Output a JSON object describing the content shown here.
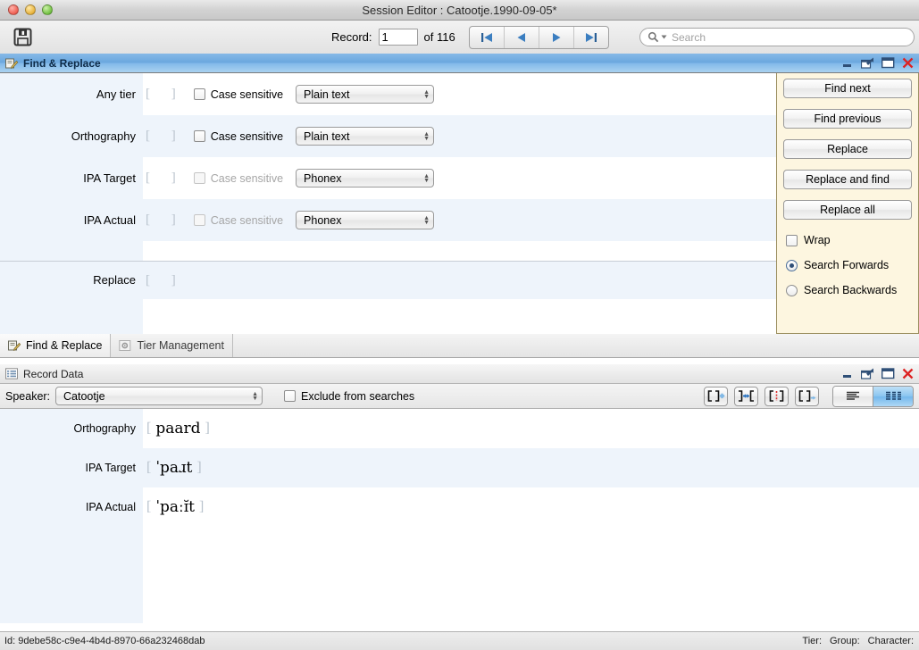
{
  "window": {
    "title": "Session Editor : Catootje.1990-09-05*",
    "traffic_lights": [
      "close-button",
      "minimize-button",
      "zoom-button"
    ]
  },
  "toolbar": {
    "save_icon": "save-disk-icon",
    "record_label": "Record:",
    "record_value": "1",
    "of_label": "of 116",
    "nav": [
      {
        "name": "first-record-button",
        "icon": "skip-to-start-icon"
      },
      {
        "name": "previous-record-button",
        "icon": "triangle-left-icon"
      },
      {
        "name": "next-record-button",
        "icon": "triangle-right-icon"
      },
      {
        "name": "last-record-button",
        "icon": "skip-to-end-icon"
      }
    ],
    "search_placeholder": "Search",
    "search_value": "",
    "search_icon": "magnifier-icon"
  },
  "find_replace": {
    "title": "Find & Replace",
    "title_icon": "find-replace-icon",
    "window_controls": [
      {
        "name": "minimize-icon",
        "label": "_"
      },
      {
        "name": "float-icon",
        "label": "float"
      },
      {
        "name": "maximize-icon",
        "label": "maximize"
      },
      {
        "name": "close-icon",
        "label": "x"
      }
    ],
    "rows": [
      {
        "label": "Any tier",
        "field_value": "",
        "case_sensitive_label": "Case sensitive",
        "case_sensitive_checked": false,
        "case_sensitive_enabled": true,
        "mode": "Plain text",
        "stripe": "white"
      },
      {
        "label": "Orthography",
        "field_value": "",
        "case_sensitive_label": "Case sensitive",
        "case_sensitive_checked": false,
        "case_sensitive_enabled": true,
        "mode": "Plain text",
        "stripe": "lblue"
      },
      {
        "label": "IPA Target",
        "field_value": "",
        "case_sensitive_label": "Case sensitive",
        "case_sensitive_checked": false,
        "case_sensitive_enabled": false,
        "mode": "Phonex",
        "stripe": "white"
      },
      {
        "label": "IPA Actual",
        "field_value": "",
        "case_sensitive_label": "Case sensitive",
        "case_sensitive_checked": false,
        "case_sensitive_enabled": false,
        "mode": "Phonex",
        "stripe": "lblue"
      }
    ],
    "replace": {
      "label": "Replace",
      "field_value": ""
    },
    "buttons": [
      "Find next",
      "Find previous",
      "Replace",
      "Replace and find",
      "Replace all"
    ],
    "options": {
      "wrap": {
        "label": "Wrap",
        "checked": false
      },
      "forwards": {
        "label": "Search Forwards",
        "selected": true
      },
      "backwards": {
        "label": "Search Backwards",
        "selected": false
      }
    }
  },
  "tabs": [
    {
      "label": "Find & Replace",
      "icon": "find-replace-icon",
      "active": true
    },
    {
      "label": "Tier Management",
      "icon": "tier-management-icon",
      "active": false
    }
  ],
  "record_data": {
    "title": "Record Data",
    "title_icon": "record-list-icon",
    "window_controls": [
      {
        "name": "minimize-icon",
        "label": "_"
      },
      {
        "name": "float-icon",
        "label": "float"
      },
      {
        "name": "maximize-icon",
        "label": "maximize"
      },
      {
        "name": "close-icon",
        "label": "x"
      }
    ],
    "speaker_label": "Speaker:",
    "speaker_value": "Catootje",
    "exclude_label": "Exclude from searches",
    "exclude_checked": false,
    "group_buttons": [
      {
        "name": "add-group-button",
        "glyph": "[ ]+"
      },
      {
        "name": "merge-group-button",
        "glyph": "}={"
      },
      {
        "name": "split-group-button",
        "glyph": "[ | ]"
      },
      {
        "name": "remove-group-button",
        "glyph": "[ ]→"
      }
    ],
    "view_toggles": [
      {
        "name": "single-column-view-button",
        "selected": false
      },
      {
        "name": "multi-column-view-button",
        "selected": true
      }
    ],
    "tiers": [
      {
        "label": "Orthography",
        "value": "paard",
        "stripe": "white"
      },
      {
        "label": "IPA Target",
        "value": "ˈpaɹt",
        "stripe": "lblue"
      },
      {
        "label": "IPA Actual",
        "value": "ˈpaːɪ̆t",
        "stripe": "white"
      }
    ]
  },
  "status_bar": {
    "id_text": "Id: 9debe58c-c9e4-4b4d-8970-66a232468dab",
    "tier_label": "Tier:",
    "group_label": "Group:",
    "character_label": "Character:"
  }
}
